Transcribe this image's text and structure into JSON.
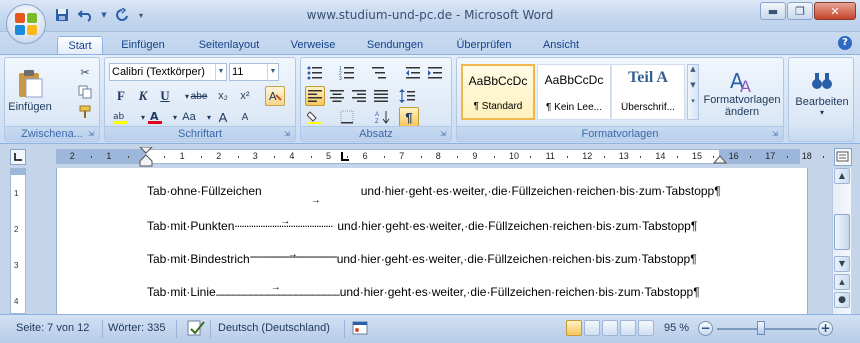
{
  "window": {
    "title": "www.studium-und-pc.de - Microsoft Word"
  },
  "tabs": [
    "Start",
    "Einfügen",
    "Seitenlayout",
    "Verweise",
    "Sendungen",
    "Überprüfen",
    "Ansicht"
  ],
  "ribbon": {
    "clipboard": {
      "label": "Zwischena...",
      "paste": "Einfügen"
    },
    "font": {
      "label": "Schriftart",
      "name": "Calibri (Textkörper)",
      "size": "11",
      "bold": "F",
      "italic": "K",
      "underline": "U",
      "strike": "abe",
      "sub": "x₂",
      "sup": "x²",
      "grow": "A",
      "shrink": "A",
      "case": "Aa"
    },
    "paragraph": {
      "label": "Absatz"
    },
    "styles": {
      "label": "Formatvorlagen",
      "items": [
        {
          "sample": "AaBbCcDc",
          "name": "¶ Standard"
        },
        {
          "sample": "AaBbCcDc",
          "name": "¶ Kein Lee..."
        },
        {
          "sample": "Teil A",
          "name": "Überschrif..."
        }
      ],
      "change_btn": "Formatvorlagen",
      "change_btn2": "ändern"
    },
    "editing": {
      "label": "Bearbeiten"
    }
  },
  "ruler": {
    "numbers": [
      "2",
      "1",
      "1",
      "2",
      "3",
      "4",
      "5",
      "6",
      "7",
      "8",
      "9",
      "10",
      "11",
      "12",
      "13",
      "14",
      "15",
      "16",
      "17",
      "18"
    ]
  },
  "vruler": {
    "numbers": [
      "1",
      "2",
      "3",
      "4"
    ]
  },
  "document": {
    "lines": [
      {
        "label": "Tab·ohne·Füllzeichen",
        "fill": "",
        "rest": "und·hier·geht·es·weiter,·die·Füllzeichen·reichen·bis·zum·Tabstopp¶"
      },
      {
        "label": "Tab·mit·Punkten",
        "fill": "..........................................",
        "rest": "und·hier·geht·es·weiter,·die·Füllzeichen·reichen·bis·zum·Tabstopp¶"
      },
      {
        "label": "Tab·mit·Bindestrich",
        "fill": "-----------------------------",
        "rest": "und·hier·geht·es·weiter,·die·Füllzeichen·reichen·bis·zum·Tabstopp¶"
      },
      {
        "label": "Tab·mit·Linie",
        "fill": "_______________________",
        "rest": "und·hier·geht·es·weiter,·die·Füllzeichen·reichen·bis·zum·Tabstopp¶"
      }
    ]
  },
  "statusbar": {
    "page": "Seite: 7 von 12",
    "words": "Wörter: 335",
    "language": "Deutsch (Deutschland)",
    "zoom": "95 %"
  }
}
